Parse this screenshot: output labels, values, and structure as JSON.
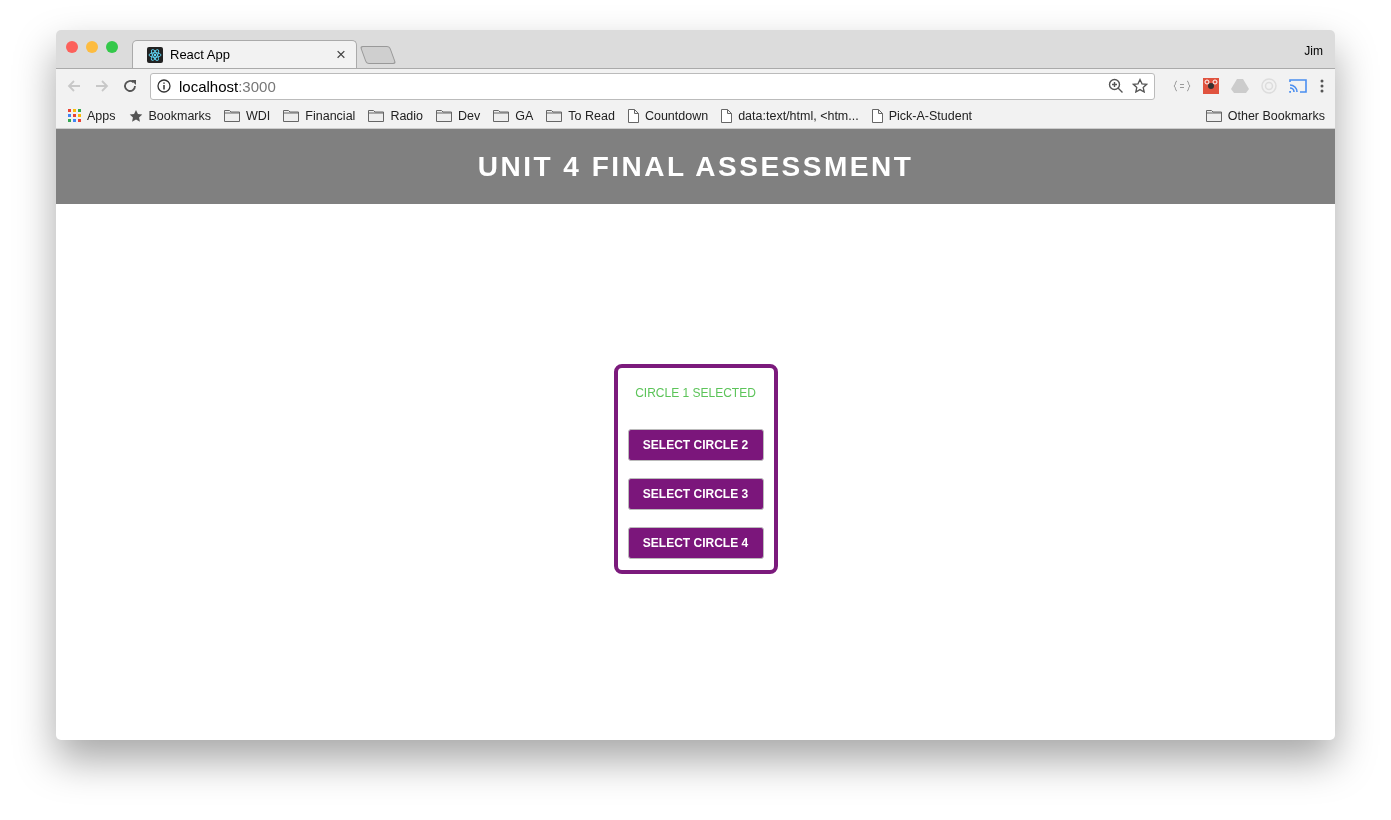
{
  "browser": {
    "tabs": [
      {
        "title": "React App",
        "close": "×",
        "selected": true
      }
    ],
    "profile": "Jim",
    "address": {
      "host": "localhost",
      "port": ":3000"
    },
    "bookmarks": [
      {
        "kind": "apps",
        "label": "Apps"
      },
      {
        "kind": "star",
        "label": "Bookmarks"
      },
      {
        "kind": "folder",
        "label": "WDI"
      },
      {
        "kind": "folder",
        "label": "Financial"
      },
      {
        "kind": "folder",
        "label": "Radio"
      },
      {
        "kind": "folder",
        "label": "Dev"
      },
      {
        "kind": "folder",
        "label": "GA"
      },
      {
        "kind": "folder",
        "label": "To Read"
      },
      {
        "kind": "page",
        "label": "Countdown"
      },
      {
        "kind": "page",
        "label": "data:text/html, <htm..."
      },
      {
        "kind": "page",
        "label": "Pick-A-Student"
      }
    ],
    "other_bookmarks": "Other Bookmarks"
  },
  "page": {
    "header": "UNIT 4 FINAL ASSESSMENT",
    "status": "CIRCLE 1 SELECTED",
    "buttons": [
      {
        "label": "SELECT CIRCLE 2"
      },
      {
        "label": "SELECT CIRCLE 3"
      },
      {
        "label": "SELECT CIRCLE 4"
      }
    ]
  }
}
